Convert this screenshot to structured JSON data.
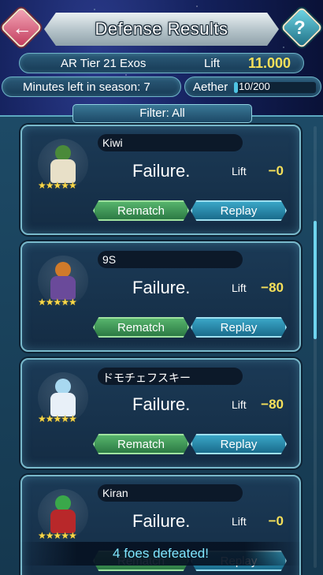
{
  "header": {
    "title": "Defense Results",
    "back_icon": "back-arrow-icon",
    "help_icon": "question-icon",
    "help_label": "?"
  },
  "tier_bar": {
    "tier_text": "AR Tier 21   Exos",
    "lift_label": "Lift",
    "lift_value": "11.000"
  },
  "season": {
    "minutes_text": "Minutes left in season: 7"
  },
  "aether": {
    "label": "Aether",
    "value_text": "10/200",
    "fill_fraction": 0.05
  },
  "filter": {
    "label": "Filter: All"
  },
  "results": [
    {
      "name": "Kiwi",
      "result": "Failure.",
      "lift_label": "Lift",
      "lift_delta": "−0",
      "stars": "★★★★★",
      "rematch": "Rematch",
      "replay": "Replay",
      "colors": {
        "hair": "#4a8a3a",
        "body": "#e8e0c8"
      }
    },
    {
      "name": "9S",
      "result": "Failure.",
      "lift_label": "Lift",
      "lift_delta": "−80",
      "stars": "★★★★★",
      "rematch": "Rematch",
      "replay": "Replay",
      "colors": {
        "hair": "#d07a2a",
        "body": "#6a4a9a"
      }
    },
    {
      "name": "ドモチェフスキー",
      "result": "Failure.",
      "lift_label": "Lift",
      "lift_delta": "−80",
      "stars": "★★★★★",
      "rematch": "Rematch",
      "replay": "Replay",
      "colors": {
        "hair": "#a8d8f0",
        "body": "#e8f0f8"
      }
    },
    {
      "name": "Kiran",
      "result": "Failure.",
      "lift_label": "Lift",
      "lift_delta": "−0",
      "stars": "★★★★★",
      "rematch": "Rematch",
      "replay": "Replay",
      "colors": {
        "hair": "#3aa84a",
        "body": "#b8282a"
      }
    }
  ],
  "footer": {
    "foes_defeated": "4 foes defeated!"
  }
}
